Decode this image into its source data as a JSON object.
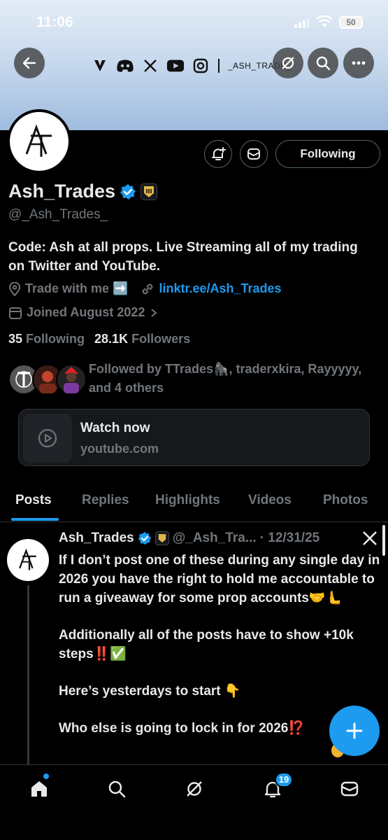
{
  "status_bar": {
    "time": "11:06",
    "battery": "50"
  },
  "banner": {
    "handle_text": "_ASH_TRADE_"
  },
  "profile": {
    "name": "Ash_Trades",
    "handle": "@_Ash_Trades_",
    "avatar_monogram": "AT",
    "bio": "Code: Ash at all props. Live Streaming all of my trading on Twitter and YouTube.",
    "location": "Trade with me ➡️",
    "website": "linktr.ee/Ash_Trades",
    "joined": "Joined August 2022",
    "following_count": "35",
    "following_label": "Following",
    "followers_count": "28.1K",
    "followers_label": "Followers",
    "followed_by": "Followed by TTrades🦍, traderxkira, Rayyyyy, and 4 others",
    "follow_button": "Following"
  },
  "card": {
    "title": "Watch now",
    "subtitle": "youtube.com"
  },
  "tabs": [
    {
      "label": "Posts",
      "active": true
    },
    {
      "label": "Replies"
    },
    {
      "label": "Highlights"
    },
    {
      "label": "Videos"
    },
    {
      "label": "Photos"
    }
  ],
  "post": {
    "name": "Ash_Trades",
    "handle": "@_Ash_Tra...",
    "date": "· 12/31/25",
    "paragraphs": [
      "If I don’t post one of these during any single day in 2026 you have the right to hold me accountable to run a giveaway for some prop accounts🤝🫷",
      "Additionally all of the posts have to show +10k steps‼️✅",
      "Here’s yesterdays to start 👇",
      "Who else is going to lock in for 2026⁉️"
    ]
  },
  "bottom_nav": {
    "notifications_badge": "19"
  },
  "colors": {
    "accent": "#1d9bf0",
    "background": "#000000",
    "muted": "#71767b"
  }
}
